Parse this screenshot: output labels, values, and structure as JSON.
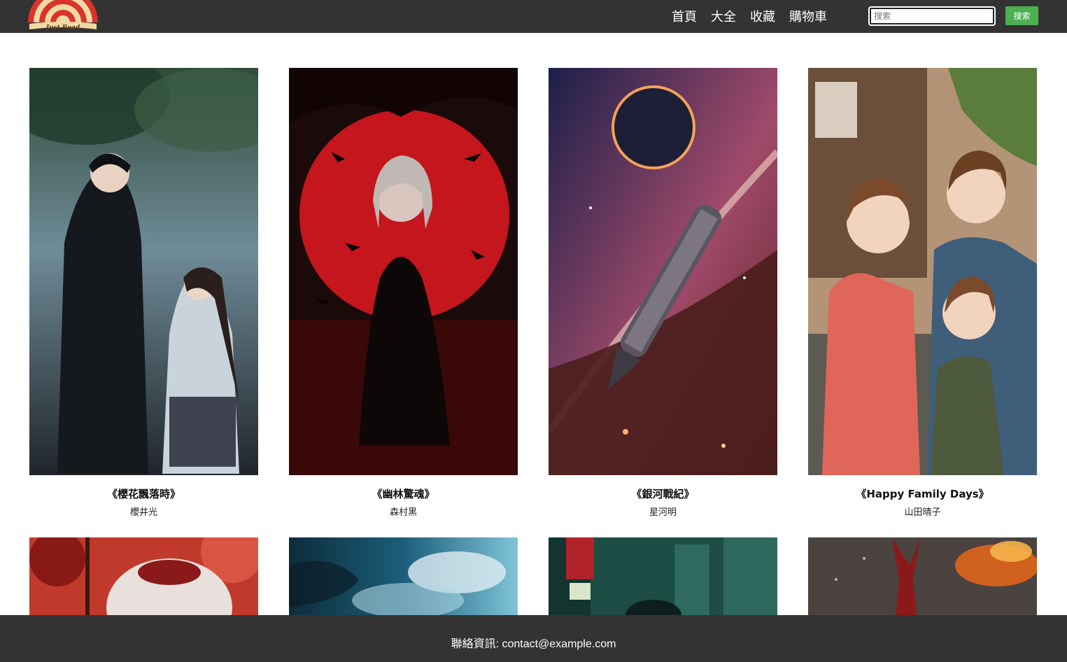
{
  "header": {
    "logo_text": "Just Read",
    "nav": [
      {
        "label": "首頁"
      },
      {
        "label": "大全"
      },
      {
        "label": "收藏"
      },
      {
        "label": "購物車"
      }
    ],
    "search": {
      "placeholder": "搜索",
      "button_label": "搜索"
    }
  },
  "books": [
    {
      "title": "《櫻花飄落時》",
      "author": "櫻井光",
      "cover_colors": [
        "#2f4b3a",
        "#6f8b98",
        "#20252b"
      ],
      "cover_icon": "couple-in-rain-illustration"
    },
    {
      "title": "《幽林驚魂》",
      "author": "森村黑",
      "cover_colors": [
        "#c4161c",
        "#1a0a0a",
        "#6b0d0d"
      ],
      "cover_icon": "girl-with-crows-illustration"
    },
    {
      "title": "《銀河戰紀》",
      "author": "星河明",
      "cover_colors": [
        "#1b1f4a",
        "#a04a6a",
        "#f2a25a"
      ],
      "cover_icon": "spaceship-illustration"
    },
    {
      "title": "《Happy Family Days》",
      "author": "山田晴子",
      "cover_colors": [
        "#5a7d3c",
        "#c9a07a",
        "#3b3b3b"
      ],
      "cover_icon": "family-illustration"
    },
    {
      "title": "",
      "author": "",
      "cover_colors": [
        "#c0392b",
        "#e8e0dc",
        "#7a1212"
      ],
      "cover_icon": "white-haired-warrior-illustration"
    },
    {
      "title": "",
      "author": "",
      "cover_colors": [
        "#1c5e7a",
        "#7fc4d8",
        "#0e2c3a"
      ],
      "cover_icon": "stormy-sky-illustration"
    },
    {
      "title": "",
      "author": "",
      "cover_colors": [
        "#1d4c44",
        "#3a7a6a",
        "#b0222a"
      ],
      "cover_icon": "neon-city-illustration"
    },
    {
      "title": "",
      "author": "",
      "cover_colors": [
        "#4a4340",
        "#8a1a1a",
        "#e8661a"
      ],
      "cover_icon": "demon-fire-illustration"
    }
  ],
  "footer": {
    "text": "聯絡資訊: contact@example.com"
  }
}
